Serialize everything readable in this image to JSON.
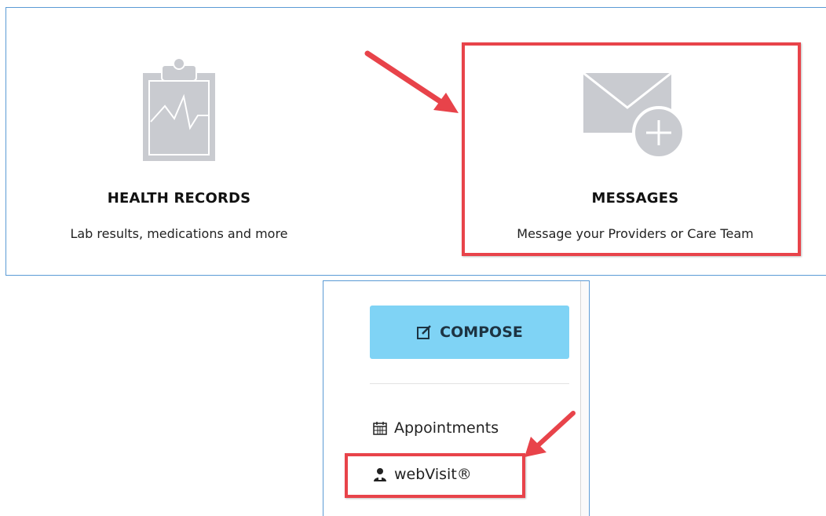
{
  "tiles": {
    "health": {
      "title": "HEALTH RECORDS",
      "subtitle": "Lab results, medications and more",
      "icon": "clipboard-heartbeat-icon"
    },
    "messages": {
      "title": "MESSAGES",
      "subtitle": "Message your Providers or Care Team",
      "icon": "envelope-plus-icon"
    }
  },
  "sidebar": {
    "compose_label": "COMPOSE",
    "items": [
      {
        "label": "Appointments",
        "icon": "calendar-icon"
      },
      {
        "label": "webVisit®",
        "icon": "doctor-icon"
      }
    ]
  },
  "colors": {
    "annotation_red": "#e8434a",
    "compose_bg": "#7fd3f5",
    "panel_border": "#5b9bd5",
    "icon_gray": "#c9cbd0"
  }
}
